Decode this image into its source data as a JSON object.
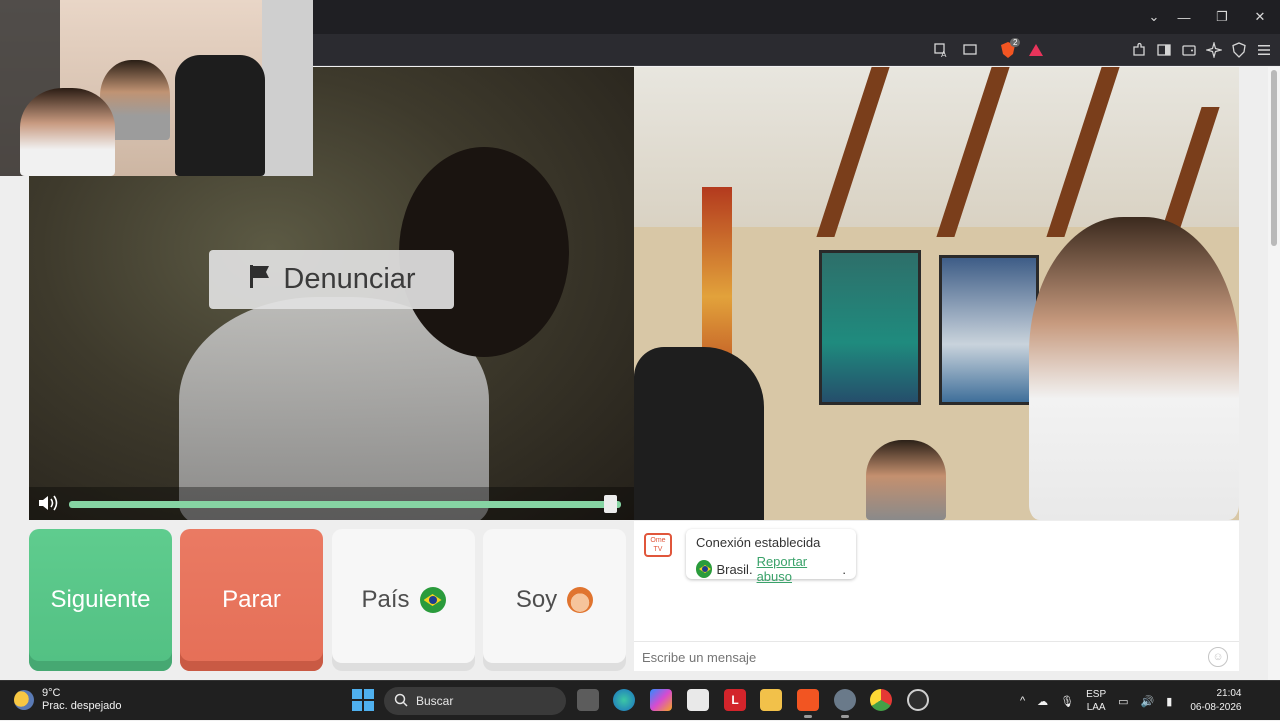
{
  "browser": {
    "window_controls": {
      "chevron": "⌄",
      "minimize": "—",
      "restore": "❐",
      "close": "✕"
    },
    "toolbar_icons": [
      "translate-icon",
      "cast-icon",
      "brave-shields-icon",
      "brave-rewards-icon",
      "extensions-icon",
      "sidebar-icon",
      "wallet-icon",
      "leo-ai-icon",
      "vpn-icon",
      "menu-icon"
    ],
    "brave_badge": "2"
  },
  "stranger_video": {
    "report_label": "Denunciar",
    "volume_level": 0.98
  },
  "controls": {
    "next_label": "Siguiente",
    "stop_label": "Parar",
    "country_label": "País",
    "gender_label": "Soy"
  },
  "chat": {
    "logo_text": "Ome TV",
    "status_message": "Conexión establecida",
    "country_name": "Brasil.",
    "report_link": "Reportar abuso",
    "report_suffix": ".",
    "input_placeholder": "Escribe un mensaje"
  },
  "taskbar": {
    "weather_temp": "9°C",
    "weather_desc": "Prac. despejado",
    "search_label": "Buscar",
    "lang_line1": "ESP",
    "lang_line2": "LAA",
    "time": "21:04",
    "date": "06-08-2026",
    "lexicon_icon_letter": "L"
  },
  "colors": {
    "next_green": "#5fcc8e",
    "stop_red": "#ea7a63",
    "accent_link": "#3aa26a",
    "taskbar_bg": "#202020"
  }
}
